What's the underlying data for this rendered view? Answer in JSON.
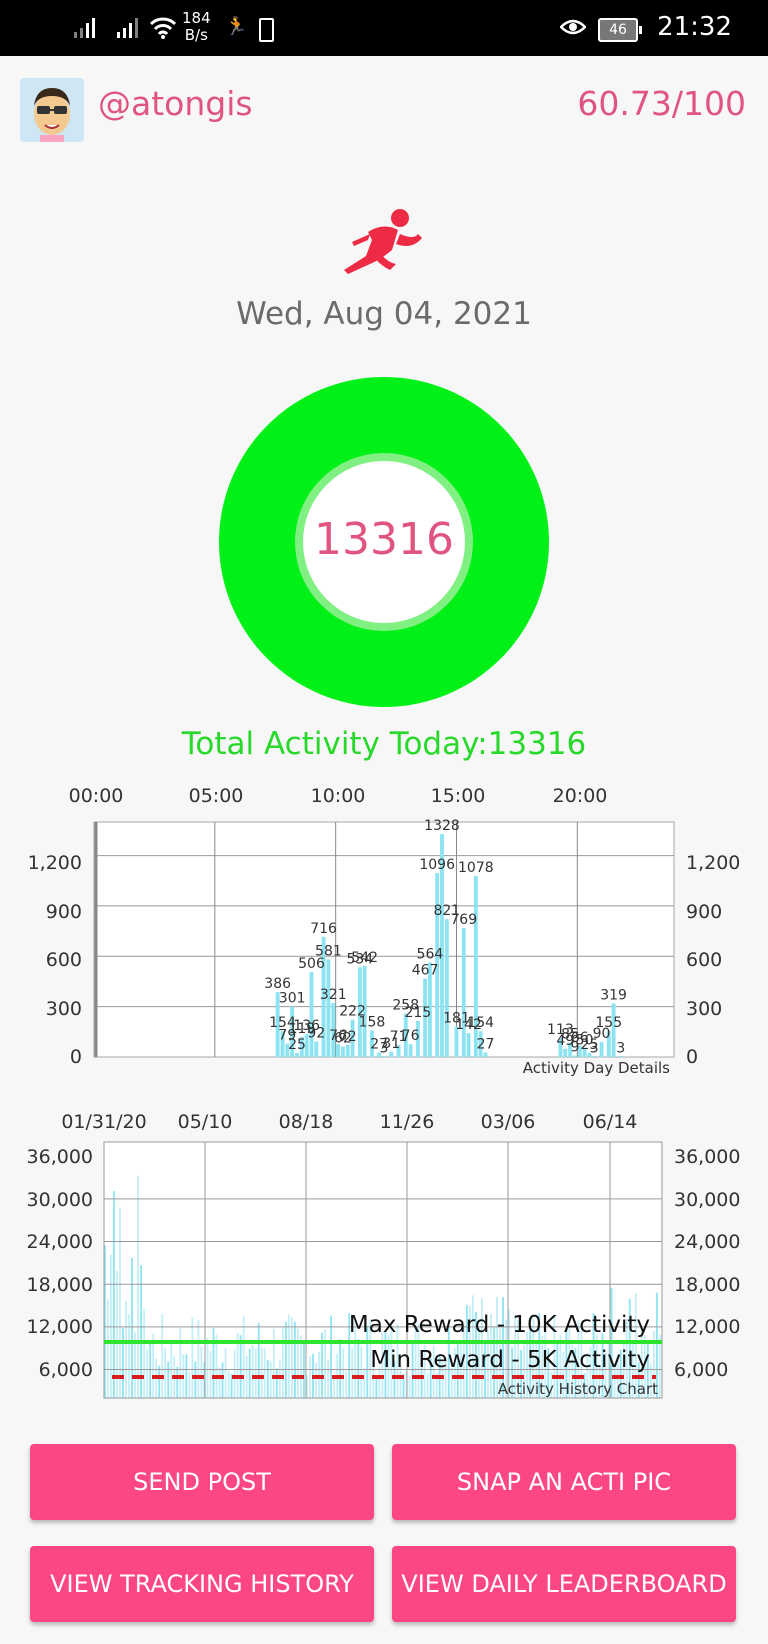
{
  "status_bar": {
    "net_speed_value": "184",
    "net_speed_unit": "B/s",
    "battery_level": "46",
    "time": "21:32"
  },
  "header": {
    "username": "@atongis",
    "score": "60.73/100"
  },
  "date": "Wed, Aug 04, 2021",
  "ring": {
    "value": "13316",
    "color": "#00f018"
  },
  "total_label": "Total Activity Today:13316",
  "day_chart": {
    "x_ticks": [
      "00:00",
      "05:00",
      "10:00",
      "15:00",
      "20:00"
    ],
    "y_ticks": [
      "0",
      "300",
      "600",
      "900",
      "1,200"
    ],
    "caption": "Activity Day Details"
  },
  "history_chart": {
    "x_ticks": [
      "01/31/20",
      "05/10",
      "08/18",
      "11/26",
      "03/06",
      "06/14"
    ],
    "y_ticks": [
      "6,000",
      "12,000",
      "18,000",
      "24,000",
      "30,000",
      "36,000"
    ],
    "max_label": "Max Reward - 10K Activity",
    "min_label": "Min Reward - 5K Activity",
    "caption": "Activity History Chart"
  },
  "chart_data": [
    {
      "type": "bar",
      "title": "Activity Day Details",
      "x_unit": "hour",
      "xlim": [
        0,
        24
      ],
      "ylim": [
        0,
        1400
      ],
      "grid": true,
      "bars": [
        {
          "x": 7.6,
          "value": 386
        },
        {
          "x": 7.8,
          "value": 154
        },
        {
          "x": 8.0,
          "value": 79
        },
        {
          "x": 8.2,
          "value": 301
        },
        {
          "x": 8.4,
          "value": 25
        },
        {
          "x": 8.6,
          "value": 119
        },
        {
          "x": 8.8,
          "value": 136
        },
        {
          "x": 9.0,
          "value": 506
        },
        {
          "x": 9.2,
          "value": 92
        },
        {
          "x": 9.5,
          "value": 716
        },
        {
          "x": 9.7,
          "value": 581
        },
        {
          "x": 9.9,
          "value": 321
        },
        {
          "x": 10.1,
          "value": 76
        },
        {
          "x": 10.3,
          "value": 62
        },
        {
          "x": 10.5,
          "value": 72
        },
        {
          "x": 10.7,
          "value": 222
        },
        {
          "x": 11.0,
          "value": 534
        },
        {
          "x": 11.2,
          "value": 542
        },
        {
          "x": 11.5,
          "value": 158
        },
        {
          "x": 11.8,
          "value": 27
        },
        {
          "x": 12.0,
          "value": 3
        },
        {
          "x": 12.3,
          "value": 31
        },
        {
          "x": 12.6,
          "value": 71
        },
        {
          "x": 12.9,
          "value": 258
        },
        {
          "x": 13.1,
          "value": 76
        },
        {
          "x": 13.4,
          "value": 215
        },
        {
          "x": 13.7,
          "value": 467
        },
        {
          "x": 13.9,
          "value": 564
        },
        {
          "x": 14.2,
          "value": 1096
        },
        {
          "x": 14.4,
          "value": 1328
        },
        {
          "x": 14.6,
          "value": 821
        },
        {
          "x": 15.0,
          "value": 181
        },
        {
          "x": 15.3,
          "value": 769
        },
        {
          "x": 15.5,
          "value": 142
        },
        {
          "x": 15.8,
          "value": 1078
        },
        {
          "x": 16.0,
          "value": 154
        },
        {
          "x": 16.2,
          "value": 27
        },
        {
          "x": 19.3,
          "value": 113
        },
        {
          "x": 19.5,
          "value": 49
        },
        {
          "x": 19.7,
          "value": 85
        },
        {
          "x": 19.9,
          "value": 9
        },
        {
          "x": 20.1,
          "value": 66
        },
        {
          "x": 20.3,
          "value": 50
        },
        {
          "x": 20.5,
          "value": 25
        },
        {
          "x": 20.7,
          "value": 3
        },
        {
          "x": 21.0,
          "value": 90
        },
        {
          "x": 21.3,
          "value": 155
        },
        {
          "x": 21.5,
          "value": 319
        },
        {
          "x": 21.8,
          "value": 3
        }
      ]
    },
    {
      "type": "bar",
      "title": "Activity History Chart",
      "ylim": [
        2000,
        38000
      ],
      "grid": true,
      "reference_lines": [
        {
          "label": "Max Reward - 10K Activity",
          "value": 10000,
          "color": "#2ee52e",
          "style": "solid"
        },
        {
          "label": "Min Reward - 5K Activity",
          "value": 5000,
          "color": "#d91c1c",
          "style": "dashed"
        }
      ]
    }
  ],
  "buttons": {
    "send_post": "SEND POST",
    "snap_pic": "SNAP AN ACTI PIC",
    "view_history": "VIEW TRACKING HISTORY",
    "view_leaderboard": "VIEW DAILY LEADERBOARD"
  }
}
